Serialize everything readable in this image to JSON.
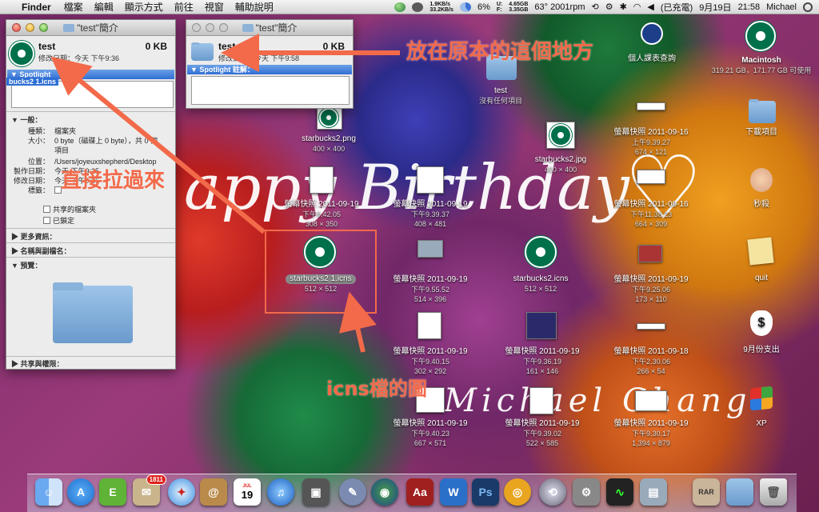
{
  "menubar": {
    "app": "Finder",
    "menus": [
      "檔案",
      "編輯",
      "顯示方式",
      "前往",
      "視窗",
      "輔助說明"
    ],
    "net_up": "1.9KB/s",
    "net_down": "33.2KB/s",
    "cpu": "6%",
    "disk_used": "4.65GB",
    "disk_free": "3.35GB",
    "disk_used_label": "U:",
    "disk_free_label": "F:",
    "temp_rpm": "63° 2001rpm",
    "battery": "(已充電)",
    "date": "9月19日",
    "time": "21:58",
    "user": "Michael"
  },
  "info_left": {
    "title": "\"test\"簡介",
    "name": "test",
    "size": "0 KB",
    "modified": "修改日期：今天 下午9:36",
    "spotlight_overlap": "bucks2 1.icns",
    "spotlight_label": "Spotlight",
    "general_header": "一般：",
    "kind_label": "種類：",
    "kind_value": "檔案夾",
    "size_label": "大小：",
    "size_value": "0 byte（磁碟上 0 byte），共 0 個",
    "size_value2": "項目",
    "where_label": "位置：",
    "where_value": "/Users/joyeuxshepherd/Desktop",
    "created_label": "製作日期：",
    "created_value": "今天 下午9:35",
    "mod_label": "修改日期：",
    "mod_value": "今天 下午9:36",
    "tags_label": "標籤：",
    "shared_label": "共享的檔案夾",
    "locked_label": "已鎖定",
    "more_info": "更多資訊：",
    "name_ext": "名稱與副檔名：",
    "preview": "預覽：",
    "sharing": "共享與權限："
  },
  "info_right": {
    "title": "\"test\"簡介",
    "name": "test",
    "size": "0 KB",
    "modified": "修改日期：今天 下午9:58",
    "spotlight": "Spotlight 註解："
  },
  "annotations": {
    "put_here": "放在原本的這個地方",
    "drag_here": "直接拉過來",
    "icns_pic": "icns檔的圖",
    "happy_birthday": "appy Birthday",
    "signature": "Michael Chang"
  },
  "desktop_icons": {
    "test_folder": {
      "name": "test",
      "sub": "沒有任何項目"
    },
    "starbucks_png": {
      "name": "starbucks2.png",
      "sub": "400 × 400"
    },
    "starbucks_jpg": {
      "name": "starbucks2.jpg",
      "sub": "400 × 400"
    },
    "starbucks_icns_sel": {
      "name": "starbucks2 1.icns",
      "sub": "512 × 512"
    },
    "starbucks_icns": {
      "name": "starbucks2.icns",
      "sub": "512 × 512"
    },
    "shot_0919_9_42_05": {
      "name": "螢幕快照 2011-09-19",
      "time": "下午9.42.05",
      "sub": "308 × 350"
    },
    "shot_0919_9_39_37": {
      "name": "螢幕快照 2011-09-19",
      "time": "下午9.39.37",
      "sub": "408 × 481"
    },
    "shot_0916_9_39_27": {
      "name": "螢幕快照 2011-09-16",
      "time": "上午9.39.27",
      "sub": "674 × 121"
    },
    "shot_0916_11_38_23": {
      "name": "螢幕快照 2011-09-16",
      "time": "下午11.38.23",
      "sub": "664 × 309"
    },
    "shot_0919_9_55_52": {
      "name": "螢幕快照 2011-09-19",
      "time": "下午9.55.52",
      "sub": "514 × 396"
    },
    "shot_0919_9_25_06": {
      "name": "螢幕快照 2011-09-19",
      "time": "下午9.25.06",
      "sub": "173 × 110"
    },
    "shot_0919_9_40_15": {
      "name": "螢幕快照 2011-09-19",
      "time": "下午9.40.15",
      "sub": "302 × 292"
    },
    "shot_0919_9_36_19": {
      "name": "螢幕快照 2011-09-19",
      "time": "下午9.36.19",
      "sub": "161 × 146"
    },
    "shot_0918_2_30_06": {
      "name": "螢幕快照 2011-09-18",
      "time": "下午2.30.06",
      "sub": "266 × 54"
    },
    "shot_0919_9_40_23": {
      "name": "螢幕快照 2011-09-19",
      "time": "下午9.40.23",
      "sub": "667 × 571"
    },
    "shot_0919_9_39_02": {
      "name": "螢幕快照 2011-09-19",
      "time": "下午9.39.02",
      "sub": "522 × 585"
    },
    "shot_0919_9_30_17": {
      "name": "螢幕快照 2011-09-19",
      "time": "下午9.30.17",
      "sub": "1,394 × 879"
    },
    "course_query": {
      "name": "個人課表查詢"
    },
    "macintosh": {
      "name": "Macintosh",
      "sub": "319.21 GB，171.77 GB 可使用"
    },
    "downloads": {
      "name": "下載項目"
    },
    "miao": {
      "name": "秒殺"
    },
    "quit": {
      "name": "quit"
    },
    "expenses": {
      "name": "9月份支出"
    },
    "xp": {
      "name": "XP"
    }
  },
  "dock": {
    "mail_badge": "1811",
    "calendar_day": "19",
    "calendar_month": "JUL"
  },
  "colors": {
    "annotation": "#f26a4a",
    "starbucks_green": "#00704a",
    "selection_blue": "#2f6fd4"
  }
}
